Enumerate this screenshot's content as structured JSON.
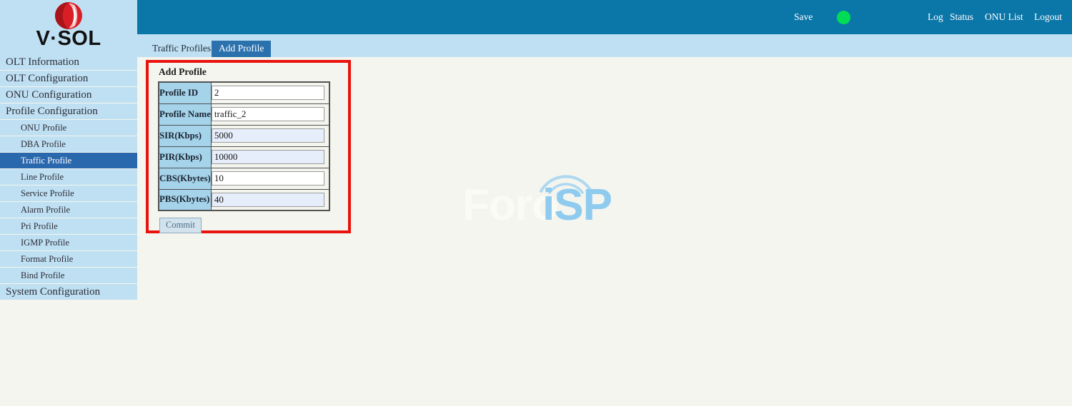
{
  "brand": {
    "name": "V·SOL",
    "logo_icon": "vsol-circle-logo"
  },
  "header": {
    "save_label": "Save",
    "status_indicator": "green-status-dot",
    "status_color": "#00dd55",
    "links": [
      {
        "label": "Log"
      },
      {
        "label": "Status"
      },
      {
        "label": "ONU List"
      },
      {
        "label": "Logout"
      }
    ],
    "background_color": "#0b76a8"
  },
  "tabs": [
    {
      "label": "Traffic Profiles",
      "active": false
    },
    {
      "label": "Add Profile",
      "active": true
    }
  ],
  "sidebar": {
    "items": [
      {
        "label": "OLT Information",
        "level": "top",
        "active": false
      },
      {
        "label": "OLT Configuration",
        "level": "top",
        "active": false
      },
      {
        "label": "ONU Configuration",
        "level": "top",
        "active": false
      },
      {
        "label": "Profile Configuration",
        "level": "top",
        "active": false
      },
      {
        "label": "ONU Profile",
        "level": "sub",
        "active": false
      },
      {
        "label": "DBA Profile",
        "level": "sub",
        "active": false
      },
      {
        "label": "Traffic Profile",
        "level": "sub",
        "active": true
      },
      {
        "label": "Line Profile",
        "level": "sub",
        "active": false
      },
      {
        "label": "Service Profile",
        "level": "sub",
        "active": false
      },
      {
        "label": "Alarm Profile",
        "level": "sub",
        "active": false
      },
      {
        "label": "Pri Profile",
        "level": "sub",
        "active": false
      },
      {
        "label": "IGMP Profile",
        "level": "sub",
        "active": false
      },
      {
        "label": "Format Profile",
        "level": "sub",
        "active": false
      },
      {
        "label": "Bind Profile",
        "level": "sub",
        "active": false
      },
      {
        "label": "System Configuration",
        "level": "top",
        "active": false
      }
    ],
    "active_color": "#2a68ad",
    "background_color": "#bfe0f2"
  },
  "panel": {
    "title": "Add Profile",
    "highlight_color": "#e8130c",
    "fields": [
      {
        "label": "Profile ID",
        "value": "2",
        "tinted": false
      },
      {
        "label": "Profile Name",
        "value": "traffic_2",
        "tinted": false
      },
      {
        "label": "SIR(Kbps)",
        "value": "5000",
        "tinted": true
      },
      {
        "label": "PIR(Kbps)",
        "value": "10000",
        "tinted": true
      },
      {
        "label": "CBS(Kbytes)",
        "value": "10",
        "tinted": false
      },
      {
        "label": "PBS(Kbytes)",
        "value": "40",
        "tinted": true
      }
    ],
    "commit_label": "Commit"
  },
  "watermark": {
    "text_part1": "Foro",
    "text_part2": "iSP",
    "accent_color": "#8ecbee"
  }
}
